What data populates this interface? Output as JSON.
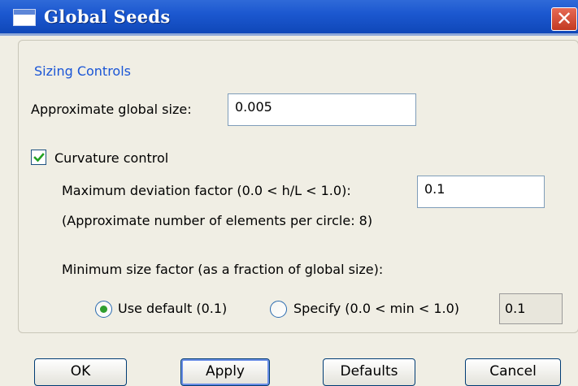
{
  "window": {
    "title": "Global Seeds",
    "close_glyph": "✕"
  },
  "sizing": {
    "group_title": "Sizing Controls",
    "global_size_label": "Approximate global size:",
    "global_size_value": "0.005"
  },
  "curvature": {
    "checkbox_label": "Curvature control",
    "checked": true,
    "deviation_label": "Maximum deviation factor (0.0 < h/L < 1.0):",
    "deviation_value": "0.1",
    "elements_note": "(Approximate number of elements per circle: 8)"
  },
  "min_size": {
    "label": "Minimum size factor (as a fraction of global size):",
    "use_default_label": "Use default (0.1)",
    "specify_label": "Specify (0.0 < min < 1.0)",
    "specify_value": "0.1",
    "selected": "use_default"
  },
  "buttons": {
    "ok": "OK",
    "apply": "Apply",
    "defaults": "Defaults",
    "cancel": "Cancel"
  },
  "colors": {
    "titlebar": "#1c58d0",
    "group_title": "#1a55d6",
    "close": "#c23a22"
  }
}
